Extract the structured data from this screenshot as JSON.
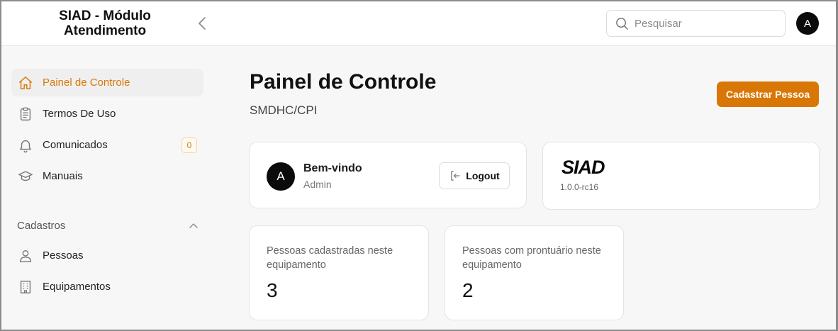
{
  "header": {
    "app_title_line1": "SIAD - Módulo",
    "app_title_line2": "Atendimento",
    "search_placeholder": "Pesquisar",
    "user_initial": "A"
  },
  "sidebar": {
    "items": [
      {
        "label": "Painel de Controle",
        "icon": "home-icon",
        "active": true
      },
      {
        "label": "Termos De Uso",
        "icon": "clipboard-icon"
      },
      {
        "label": "Comunicados",
        "icon": "bell-icon",
        "badge": "0"
      },
      {
        "label": "Manuais",
        "icon": "graduation-cap-icon"
      }
    ],
    "section": {
      "label": "Cadastros",
      "icon": "chevron-up-icon"
    },
    "section_items": [
      {
        "label": "Pessoas",
        "icon": "user-icon"
      },
      {
        "label": "Equipamentos",
        "icon": "building-icon"
      }
    ]
  },
  "main": {
    "title": "Painel de Controle",
    "subtitle": "SMDHC/CPI",
    "primary_button": "Cadastrar Pessoa",
    "welcome": {
      "avatar_initial": "A",
      "title": "Bem-vindo",
      "user": "Admin",
      "logout_label": "Logout"
    },
    "brand": {
      "logo_text": "SIAD",
      "version": "1.0.0-rc16"
    },
    "stats": [
      {
        "label": "Pessoas cadastradas neste equipamento",
        "value": "3"
      },
      {
        "label": "Pessoas com prontuário neste equipamento",
        "value": "2"
      }
    ]
  },
  "colors": {
    "accent": "#d97706",
    "active_bg": "#efefef",
    "avatar_bg": "#0b0b0b"
  }
}
